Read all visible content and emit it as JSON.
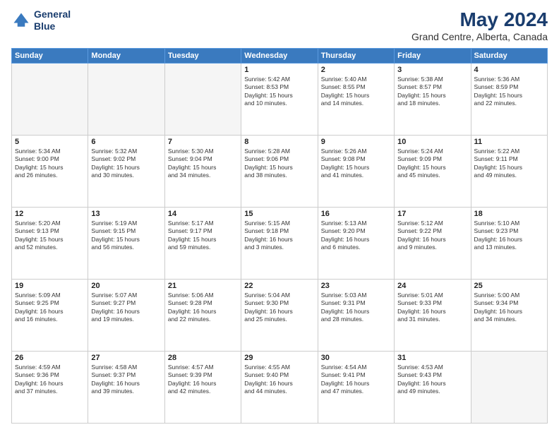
{
  "logo": {
    "line1": "General",
    "line2": "Blue"
  },
  "title": "May 2024",
  "subtitle": "Grand Centre, Alberta, Canada",
  "days_header": [
    "Sunday",
    "Monday",
    "Tuesday",
    "Wednesday",
    "Thursday",
    "Friday",
    "Saturday"
  ],
  "weeks": [
    [
      {
        "day": "",
        "info": ""
      },
      {
        "day": "",
        "info": ""
      },
      {
        "day": "",
        "info": ""
      },
      {
        "day": "1",
        "info": "Sunrise: 5:42 AM\nSunset: 8:53 PM\nDaylight: 15 hours\nand 10 minutes."
      },
      {
        "day": "2",
        "info": "Sunrise: 5:40 AM\nSunset: 8:55 PM\nDaylight: 15 hours\nand 14 minutes."
      },
      {
        "day": "3",
        "info": "Sunrise: 5:38 AM\nSunset: 8:57 PM\nDaylight: 15 hours\nand 18 minutes."
      },
      {
        "day": "4",
        "info": "Sunrise: 5:36 AM\nSunset: 8:59 PM\nDaylight: 15 hours\nand 22 minutes."
      }
    ],
    [
      {
        "day": "5",
        "info": "Sunrise: 5:34 AM\nSunset: 9:00 PM\nDaylight: 15 hours\nand 26 minutes."
      },
      {
        "day": "6",
        "info": "Sunrise: 5:32 AM\nSunset: 9:02 PM\nDaylight: 15 hours\nand 30 minutes."
      },
      {
        "day": "7",
        "info": "Sunrise: 5:30 AM\nSunset: 9:04 PM\nDaylight: 15 hours\nand 34 minutes."
      },
      {
        "day": "8",
        "info": "Sunrise: 5:28 AM\nSunset: 9:06 PM\nDaylight: 15 hours\nand 38 minutes."
      },
      {
        "day": "9",
        "info": "Sunrise: 5:26 AM\nSunset: 9:08 PM\nDaylight: 15 hours\nand 41 minutes."
      },
      {
        "day": "10",
        "info": "Sunrise: 5:24 AM\nSunset: 9:09 PM\nDaylight: 15 hours\nand 45 minutes."
      },
      {
        "day": "11",
        "info": "Sunrise: 5:22 AM\nSunset: 9:11 PM\nDaylight: 15 hours\nand 49 minutes."
      }
    ],
    [
      {
        "day": "12",
        "info": "Sunrise: 5:20 AM\nSunset: 9:13 PM\nDaylight: 15 hours\nand 52 minutes."
      },
      {
        "day": "13",
        "info": "Sunrise: 5:19 AM\nSunset: 9:15 PM\nDaylight: 15 hours\nand 56 minutes."
      },
      {
        "day": "14",
        "info": "Sunrise: 5:17 AM\nSunset: 9:17 PM\nDaylight: 15 hours\nand 59 minutes."
      },
      {
        "day": "15",
        "info": "Sunrise: 5:15 AM\nSunset: 9:18 PM\nDaylight: 16 hours\nand 3 minutes."
      },
      {
        "day": "16",
        "info": "Sunrise: 5:13 AM\nSunset: 9:20 PM\nDaylight: 16 hours\nand 6 minutes."
      },
      {
        "day": "17",
        "info": "Sunrise: 5:12 AM\nSunset: 9:22 PM\nDaylight: 16 hours\nand 9 minutes."
      },
      {
        "day": "18",
        "info": "Sunrise: 5:10 AM\nSunset: 9:23 PM\nDaylight: 16 hours\nand 13 minutes."
      }
    ],
    [
      {
        "day": "19",
        "info": "Sunrise: 5:09 AM\nSunset: 9:25 PM\nDaylight: 16 hours\nand 16 minutes."
      },
      {
        "day": "20",
        "info": "Sunrise: 5:07 AM\nSunset: 9:27 PM\nDaylight: 16 hours\nand 19 minutes."
      },
      {
        "day": "21",
        "info": "Sunrise: 5:06 AM\nSunset: 9:28 PM\nDaylight: 16 hours\nand 22 minutes."
      },
      {
        "day": "22",
        "info": "Sunrise: 5:04 AM\nSunset: 9:30 PM\nDaylight: 16 hours\nand 25 minutes."
      },
      {
        "day": "23",
        "info": "Sunrise: 5:03 AM\nSunset: 9:31 PM\nDaylight: 16 hours\nand 28 minutes."
      },
      {
        "day": "24",
        "info": "Sunrise: 5:01 AM\nSunset: 9:33 PM\nDaylight: 16 hours\nand 31 minutes."
      },
      {
        "day": "25",
        "info": "Sunrise: 5:00 AM\nSunset: 9:34 PM\nDaylight: 16 hours\nand 34 minutes."
      }
    ],
    [
      {
        "day": "26",
        "info": "Sunrise: 4:59 AM\nSunset: 9:36 PM\nDaylight: 16 hours\nand 37 minutes."
      },
      {
        "day": "27",
        "info": "Sunrise: 4:58 AM\nSunset: 9:37 PM\nDaylight: 16 hours\nand 39 minutes."
      },
      {
        "day": "28",
        "info": "Sunrise: 4:57 AM\nSunset: 9:39 PM\nDaylight: 16 hours\nand 42 minutes."
      },
      {
        "day": "29",
        "info": "Sunrise: 4:55 AM\nSunset: 9:40 PM\nDaylight: 16 hours\nand 44 minutes."
      },
      {
        "day": "30",
        "info": "Sunrise: 4:54 AM\nSunset: 9:41 PM\nDaylight: 16 hours\nand 47 minutes."
      },
      {
        "day": "31",
        "info": "Sunrise: 4:53 AM\nSunset: 9:43 PM\nDaylight: 16 hours\nand 49 minutes."
      },
      {
        "day": "",
        "info": ""
      }
    ]
  ]
}
